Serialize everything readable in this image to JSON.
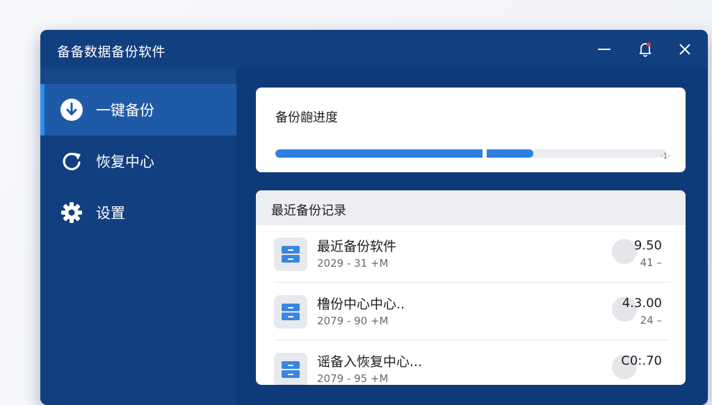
{
  "window": {
    "title": "备备数据备份软件"
  },
  "titlebar_buttons": [
    {
      "name": "minimize-icon"
    },
    {
      "name": "notification-bell-icon"
    },
    {
      "name": "close-icon"
    }
  ],
  "sidebar": {
    "items": [
      {
        "label": "一键备份",
        "icon": "download-circle-icon",
        "active": true
      },
      {
        "label": "恢复中心",
        "icon": "refresh-icon",
        "active": false
      },
      {
        "label": "设置",
        "icon": "gear-icon",
        "active": false
      }
    ]
  },
  "progress_card": {
    "label": "备份龅进度",
    "progress": 0.66,
    "value_text": "·1·"
  },
  "recent": {
    "title": "最近备份记录",
    "rows": [
      {
        "name": "最近备份软件",
        "meta": "2029 ‑ 31 +M",
        "value": "9.50",
        "sub": "41 –",
        "icon": "drawer-icon"
      },
      {
        "name": "橹份中心中心..",
        "meta": "2079 ‑ 90 +M",
        "value": "4.3.00",
        "sub": "24 –",
        "icon": "drawer-icon"
      },
      {
        "name": "谣备入恢复中心...",
        "meta": "2079 ‑ 95 +M",
        "value": "C0:.70",
        "sub": "",
        "icon": "drawer-icon"
      }
    ]
  },
  "colors": {
    "window_bg": "#0f3c7c",
    "sidebar_active": "#1f5aa6",
    "accent": "#2f7fde",
    "notification_dot": "#e53935"
  }
}
